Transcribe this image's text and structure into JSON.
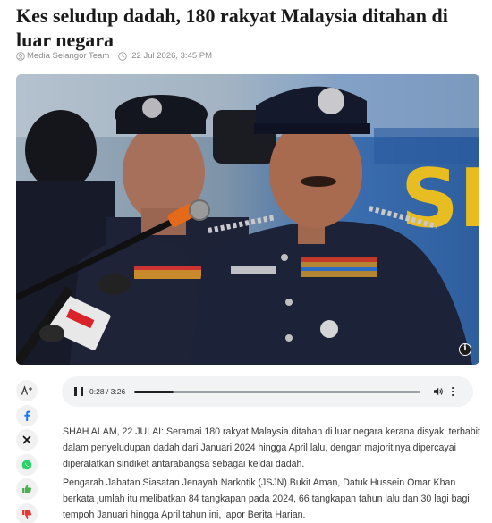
{
  "article": {
    "headline": "Kes seludup dadah, 180 rakyat Malaysia ditahan di luar negara",
    "author": "Media Selangor Team",
    "date": "22 Jul 2026, 3:45 PM",
    "info_glyph": "i",
    "paragraphs": [
      "SHAH ALAM, 22 JULAI: Seramai 180 rakyat Malaysia ditahan di luar negara kerana disyaki terbabit dalam penyeludupan dadah dari Januari 2024 hingga April lalu, dengan majoritinya dipercayai diperalatkan sindiket antarabangsa sebagai keldai dadah.",
      "Pengarah Jabatan Siasatan Jenayah Narkotik (JSJN) Bukit Aman, Datuk Hussein Omar Khan berkata jumlah itu melibatkan 84 tangkapan pada 2024, 66 tangkapan tahun lalu dan 30 lagi bagi tempoh Januari hingga April tahun ini, lapor Berita Harian."
    ]
  },
  "share": {
    "items": [
      {
        "icon": "font-size-icon",
        "color": "#333333"
      },
      {
        "icon": "facebook-icon",
        "color": "#1877f2"
      },
      {
        "icon": "x-icon",
        "color": "#111111"
      },
      {
        "icon": "whatsapp-icon",
        "color": "#25d366"
      },
      {
        "icon": "thumbs-up-icon",
        "color": "#4caf50"
      },
      {
        "icon": "thumbs-down-icon",
        "color": "#e53935"
      }
    ]
  },
  "audio": {
    "time_display": "0:28 / 3:26",
    "progress": 0.136
  },
  "colors": {
    "uniform": "#1c2238",
    "background_blue": "#3c6fb0",
    "accent_yellow": "#f2c21b"
  }
}
